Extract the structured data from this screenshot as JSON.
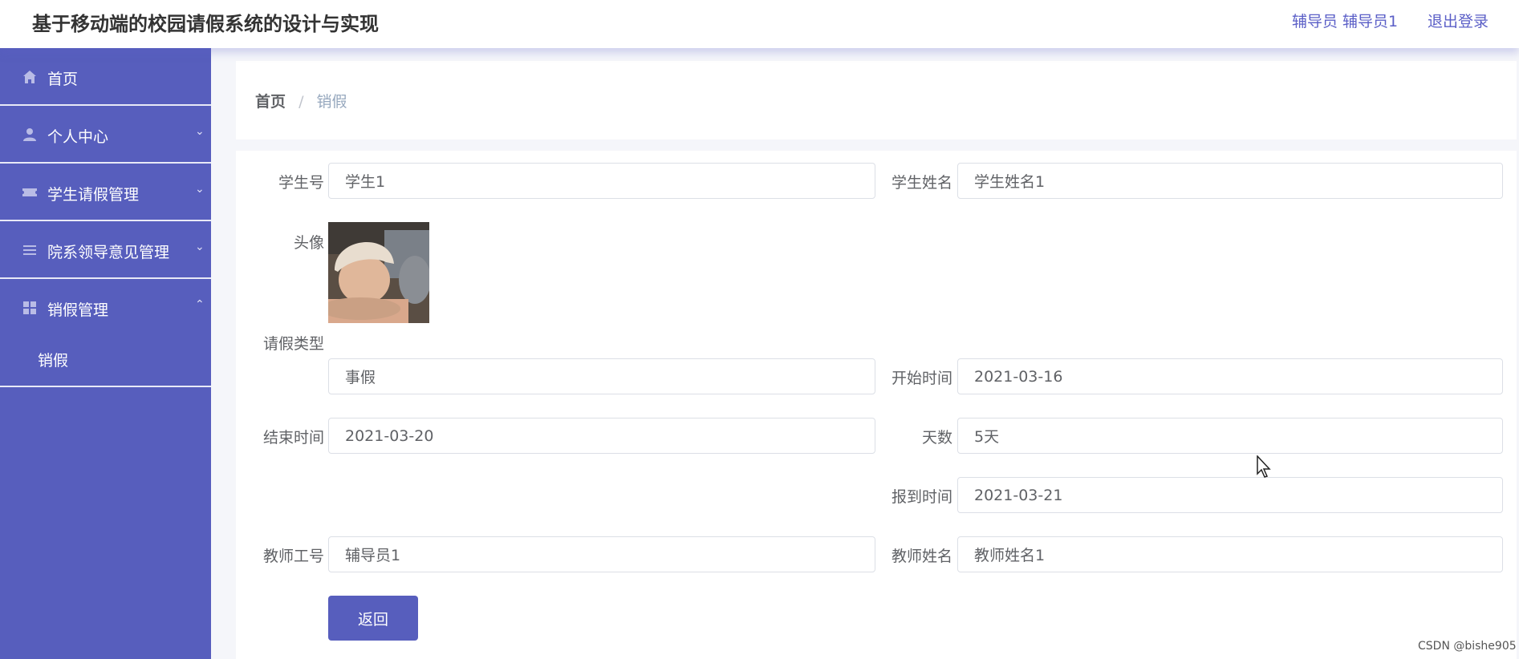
{
  "header": {
    "title": "基于移动端的校园请假系统的设计与实现",
    "user": "辅导员 辅导员1",
    "logout": "退出登录"
  },
  "sidebar": {
    "items": [
      {
        "label": "首页",
        "icon": "home-icon"
      },
      {
        "label": "个人中心",
        "icon": "user-icon",
        "arrow": "chevron-down"
      },
      {
        "label": "学生请假管理",
        "icon": "ticket-icon",
        "arrow": "chevron-down"
      },
      {
        "label": "院系领导意见管理",
        "icon": "list-icon",
        "arrow": "chevron-down"
      },
      {
        "label": "销假管理",
        "icon": "grid-icon",
        "arrow": "chevron-up"
      }
    ],
    "submenu": [
      {
        "label": "销假"
      }
    ]
  },
  "breadcrumb": {
    "home": "首页",
    "separator": "/",
    "current": "销假"
  },
  "form": {
    "student_id": {
      "label": "学生号",
      "value": "学生1"
    },
    "student_name": {
      "label": "学生姓名",
      "value": "学生姓名1"
    },
    "avatar": {
      "label": "头像"
    },
    "leave_type": {
      "label": "请假类型",
      "value": "事假"
    },
    "start_time": {
      "label": "开始时间",
      "value": "2021-03-16"
    },
    "end_time": {
      "label": "结束时间",
      "value": "2021-03-20"
    },
    "days": {
      "label": "天数",
      "value": "5天"
    },
    "report_time": {
      "label": "报到时间",
      "value": "2021-03-21"
    },
    "teacher_id": {
      "label": "教师工号",
      "value": "辅导员1"
    },
    "teacher_name": {
      "label": "教师姓名",
      "value": "教师姓名1"
    },
    "back_button": "返回"
  },
  "watermark": "CSDN @bishe905",
  "colors": {
    "accent": "#575ebd",
    "link": "#5b5fc7",
    "border": "#dcdfe6",
    "background": "#f5f6fa"
  }
}
